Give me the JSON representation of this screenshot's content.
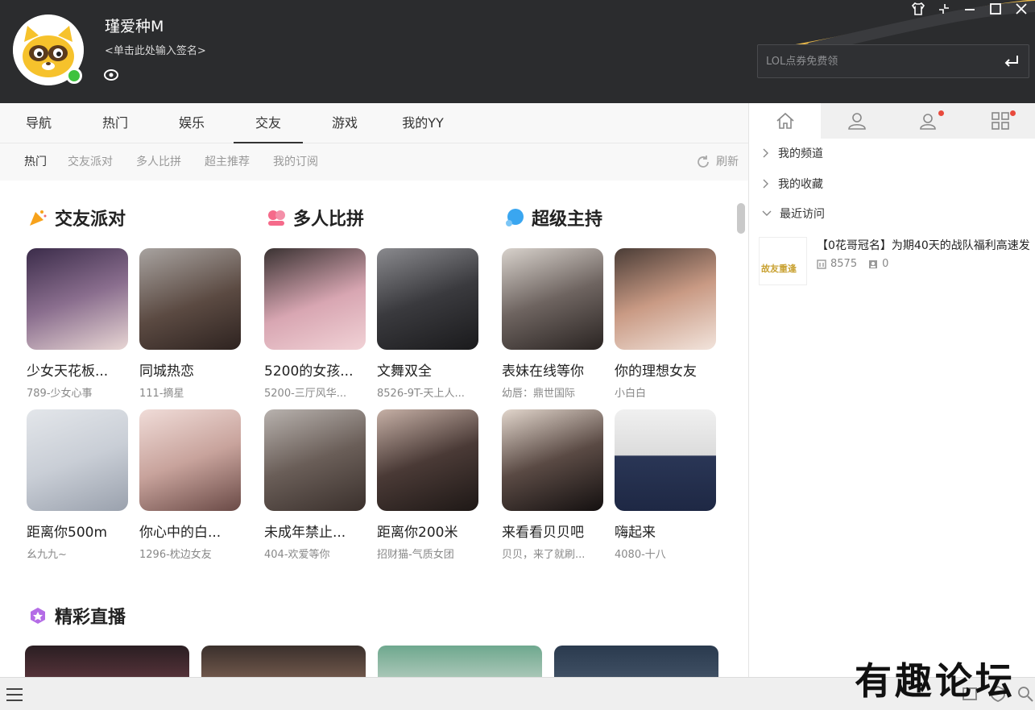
{
  "user": {
    "name": "瑾爱种M",
    "signature": "<单击此处输入签名>"
  },
  "search": {
    "placeholder": "LOL点券免费领"
  },
  "tabs": [
    "导航",
    "热门",
    "娱乐",
    "交友",
    "游戏",
    "我的YY"
  ],
  "active_tab": "交友",
  "subtabs": [
    "热门",
    "交友派对",
    "多人比拼",
    "超主推荐",
    "我的订阅"
  ],
  "refresh_label": "刷新",
  "sections": {
    "party": {
      "title": "交友派对",
      "cards": [
        {
          "title": "少女天花板...",
          "sub": "789-少女心事"
        },
        {
          "title": "同城热恋",
          "sub": "111-摘星"
        },
        {
          "title": "距离你500m",
          "sub": "幺九九~"
        },
        {
          "title": "你心中的白...",
          "sub": "1296-枕边女友"
        }
      ]
    },
    "multi": {
      "title": "多人比拼",
      "cards": [
        {
          "title": "5200的女孩...",
          "sub": "5200-三厅风华..."
        },
        {
          "title": "文舞双全",
          "sub": "8526-9T-天上人..."
        },
        {
          "title": "未成年禁止...",
          "sub": "404-欢爱等你"
        },
        {
          "title": "距离你200米",
          "sub": "招财猫-气质女团"
        }
      ]
    },
    "host": {
      "title": "超级主持",
      "cards": [
        {
          "title": "表妹在线等你",
          "sub": "幼唇：鼎世国际"
        },
        {
          "title": "你的理想女友",
          "sub": "小白白"
        },
        {
          "title": "来看看贝贝吧",
          "sub": "贝贝，来了就刷..."
        },
        {
          "title": "嗨起来",
          "sub": "4080-十八"
        }
      ]
    },
    "live": {
      "title": "精彩直播"
    }
  },
  "right_panel": {
    "tree": [
      "我的频道",
      "我的收藏",
      "最近访问"
    ],
    "recent": {
      "title": "【0花哥冠名】为期40天的战队福利高速发",
      "viewers": "8575",
      "members": "0",
      "thumb_text": "故友重逢"
    }
  },
  "watermark": "有趣论坛",
  "colors": {
    "header_bg": "#2b2c2e",
    "accent_gold": "#e8b84a",
    "online": "#3ec23e",
    "badge_red": "#e84a3c"
  }
}
